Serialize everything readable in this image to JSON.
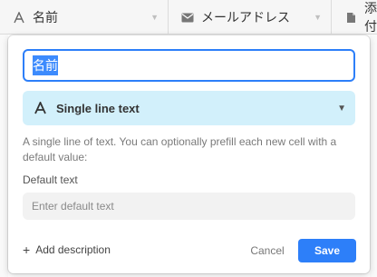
{
  "grid_header": {
    "columns": [
      {
        "name": "名前",
        "type_icon": "text-a-icon"
      },
      {
        "name": "メールアドレス",
        "type_icon": "email-icon"
      },
      {
        "name": "添付",
        "type_icon": "file-icon"
      }
    ]
  },
  "field_editor": {
    "field_name_value": "名前",
    "field_type": {
      "icon": "text-a-icon",
      "label": "Single line text"
    },
    "description": "A single line of text. You can optionally prefill each new cell with a default value:",
    "default_text_label": "Default text",
    "default_text_placeholder": "Enter default text",
    "default_text_value": "",
    "add_description_label": "Add description",
    "cancel_label": "Cancel",
    "save_label": "Save"
  },
  "colors": {
    "accent": "#2d7ff9",
    "type_select_bg": "#d2f0fb",
    "header_bg": "#f6f6f6"
  }
}
